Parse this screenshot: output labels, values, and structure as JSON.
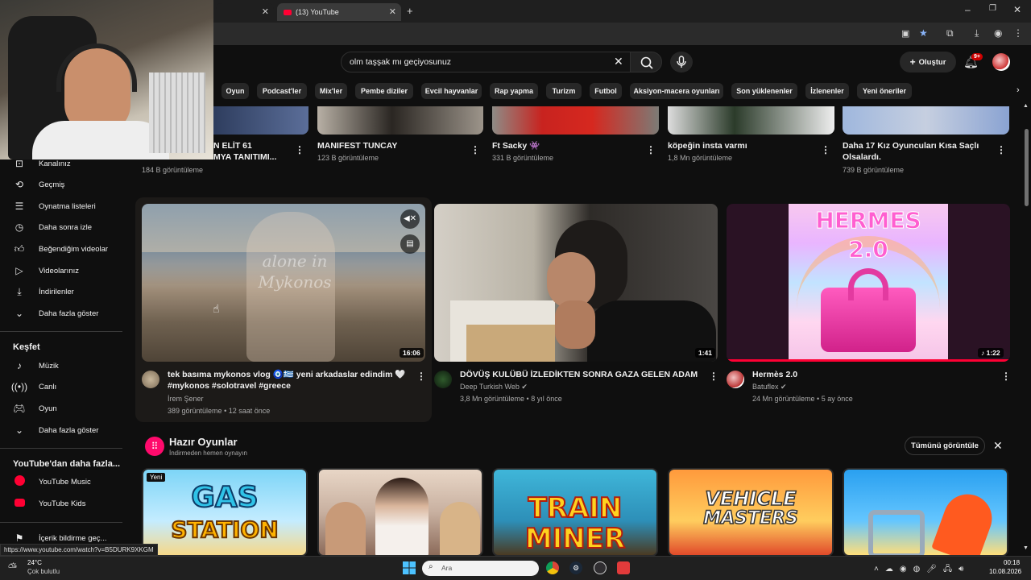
{
  "browser": {
    "tab_title": "(13) YouTube",
    "status_url": "https://www.youtube.com/watch?v=B5DURK9XKGM"
  },
  "header": {
    "search_value": "olm taşşak mı geçiyosunuz",
    "create_label": "Oluştur",
    "notifications_badge": "9+"
  },
  "chips": [
    "Oyun",
    "Podcast'ler",
    "Mix'ler",
    "Pembe diziler",
    "Evcil hayvanlar",
    "Rap yapma",
    "Turizm",
    "Futbol",
    "Aksiyon-macera oyunları",
    "Son yüklenenler",
    "İzlenenler",
    "Yeni öneriler"
  ],
  "sidebar": {
    "items_top": [
      {
        "label": "Kanalınız",
        "icon": "channel-icon"
      },
      {
        "label": "Geçmiş",
        "icon": "history-icon"
      },
      {
        "label": "Oynatma listeleri",
        "icon": "playlist-icon"
      },
      {
        "label": "Daha sonra izle",
        "icon": "clock-icon"
      },
      {
        "label": "Beğendiğim videolar",
        "icon": "thumbs-up-icon"
      },
      {
        "label": "Videolarınız",
        "icon": "video-icon"
      },
      {
        "label": "İndirilenler",
        "icon": "download-icon"
      },
      {
        "label": "Daha fazla göster",
        "icon": "chevron-down-icon"
      }
    ],
    "explore_heading": "Keşfet",
    "explore_items": [
      {
        "label": "Müzik",
        "icon": "music-icon"
      },
      {
        "label": "Canlı",
        "icon": "live-icon"
      },
      {
        "label": "Oyun",
        "icon": "gamepad-icon"
      },
      {
        "label": "Daha fazla göster",
        "icon": "chevron-down-icon"
      }
    ],
    "more_heading": "YouTube'dan daha fazla...",
    "more_items": [
      {
        "label": "YouTube Music"
      },
      {
        "label": "YouTube Kids"
      }
    ],
    "report_label": "İçerik bildirme geç..."
  },
  "top_row": [
    {
      "title_l1": "N ELİT 61",
      "title_l2": "MYA TANITIMI...",
      "views": "184 B görüntüleme"
    },
    {
      "title_l1": "MANIFEST TUNCAY",
      "title_l2": "",
      "views": "123 B görüntüleme"
    },
    {
      "title_l1": "Ft Sacky 👾",
      "title_l2": "",
      "views": "331 B görüntüleme"
    },
    {
      "title_l1": "köpeğin insta varmı",
      "title_l2": "",
      "views": "1,8 Mn görüntüleme"
    },
    {
      "title_l1": "Daha 17 Kız Oyuncuları Kısa Saçlı",
      "title_l2": "Olsalardı.",
      "views": "739 B görüntüleme"
    }
  ],
  "videos": [
    {
      "title_l1": "tek basıma mykonos vlog 🧿🇬🇷 yeni arkadaslar edindim 🤍",
      "title_l2": "#mykonos #solotravel #greece",
      "channel": "İrem Şener",
      "views": "389 görüntüleme",
      "age": "12 saat önce",
      "duration": "16:06",
      "overlay_text": "alone in Mykonos"
    },
    {
      "title_l1": "DÖVÜŞ KULÜBÜ İZLEDİKTEN SONRA GAZA GELEN ADAM",
      "title_l2": "",
      "channel": "Deep Turkish Web",
      "views": "3,8 Mn görüntüleme",
      "age": "8 yıl önce",
      "duration": "1:41"
    },
    {
      "title_l1": "Hermès 2.0",
      "title_l2": "",
      "channel": "Batuflex",
      "views": "24 Mn görüntüleme",
      "age": "5 ay önce",
      "duration": "1:22",
      "thumb_text_1": "HERMES",
      "thumb_text_2": "2.0"
    }
  ],
  "games_section": {
    "title": "Hazır Oyunlar",
    "subtitle": "İndirmeden hemen oynayın",
    "view_all": "Tümünü görüntüle",
    "new_badge": "Yeni",
    "games": [
      {
        "line1": "GAS",
        "line2": "STATION"
      },
      {
        "line1": "",
        "line2": ""
      },
      {
        "line1": "TRAIN",
        "line2": "MINER"
      },
      {
        "line1": "VEHICLE",
        "line2": "MASTERS"
      },
      {
        "line1": "",
        "line2": ""
      }
    ]
  },
  "taskbar": {
    "temp": "24°C",
    "weather": "Çok bulutlu",
    "search_placeholder": "Ara",
    "time": "00:18",
    "date": "10.08.2026"
  }
}
